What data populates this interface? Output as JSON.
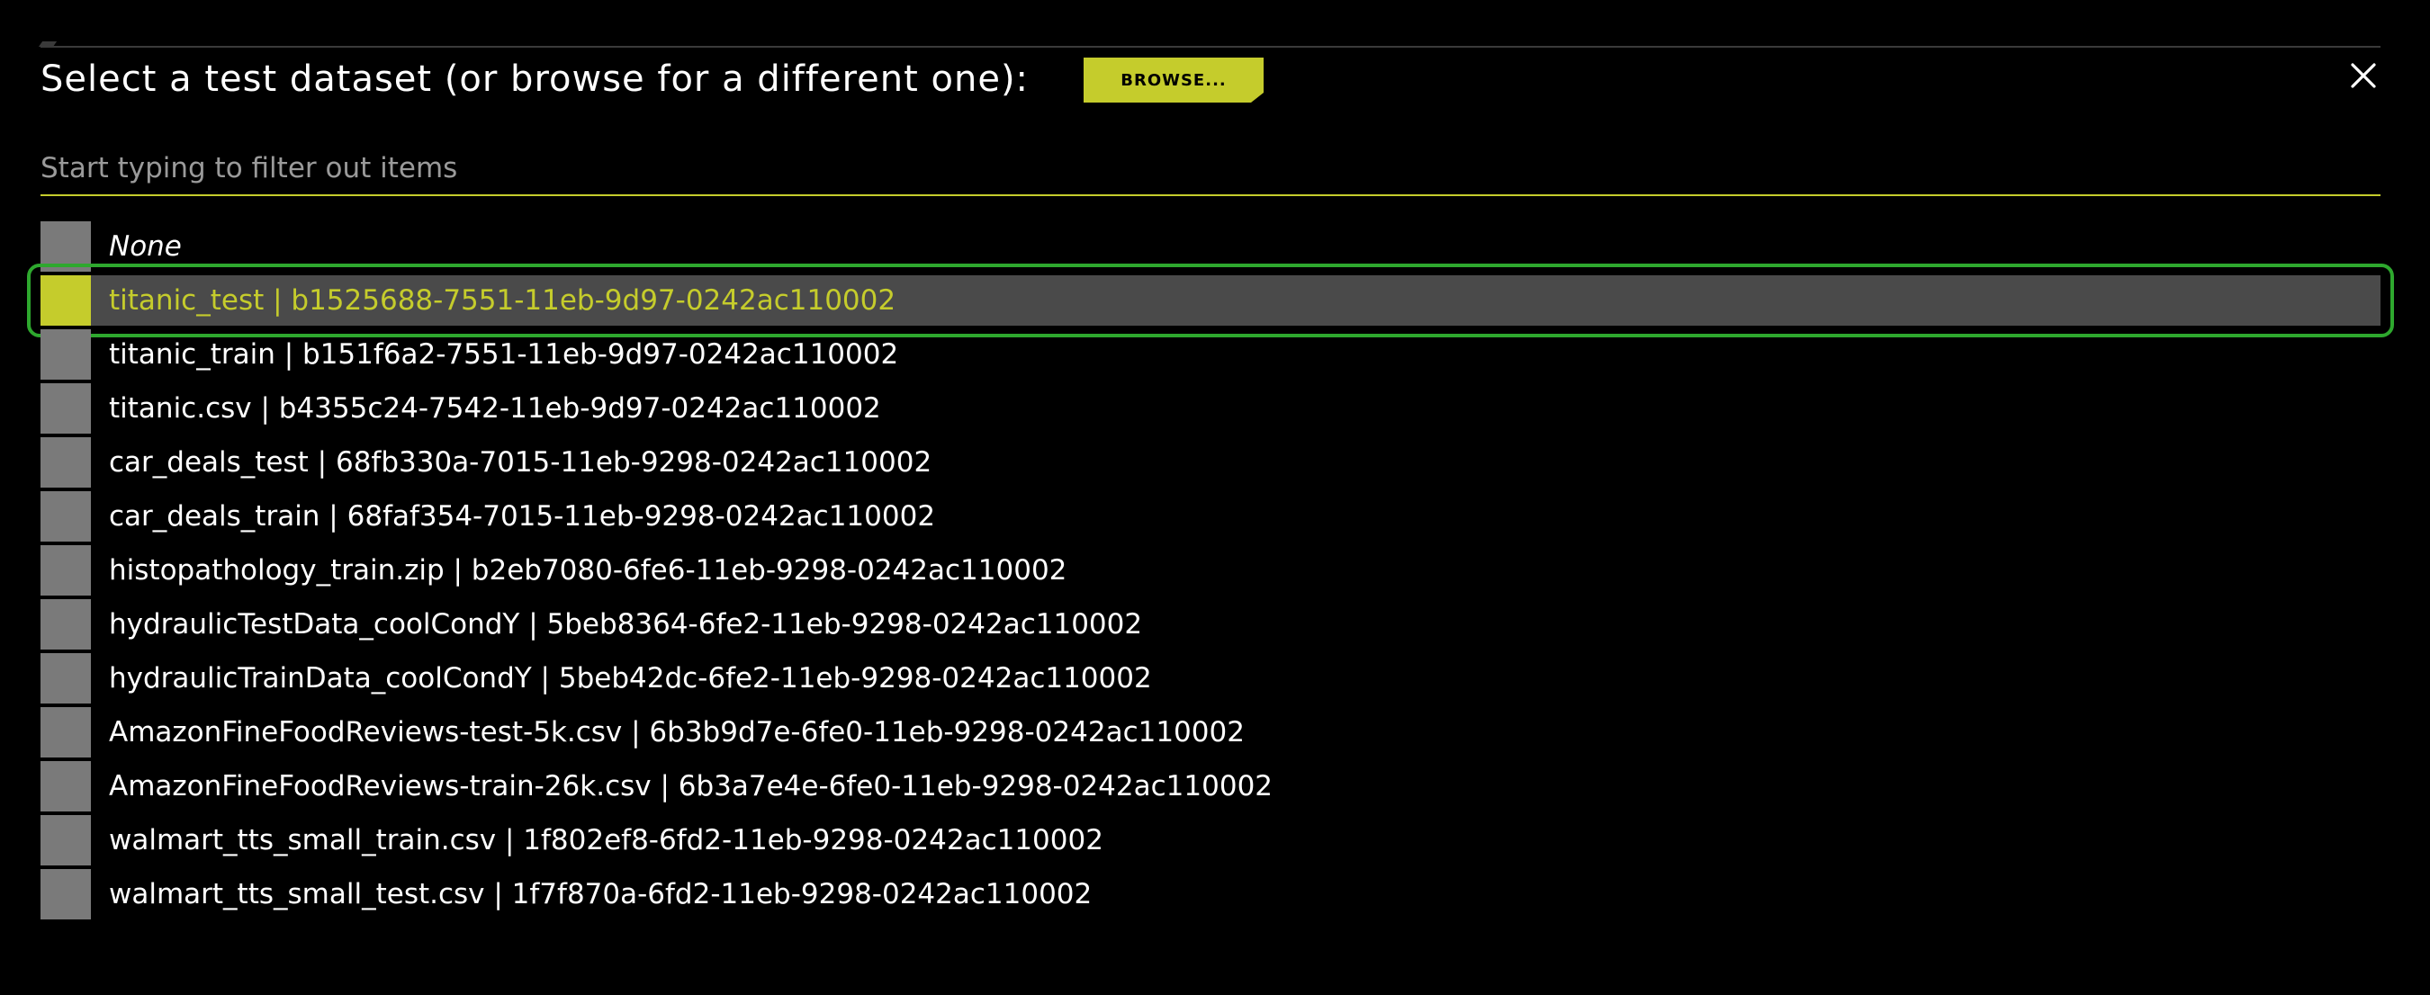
{
  "dialog": {
    "title": "Select a test dataset (or browse for a different one):",
    "browse_label": "BROWSE...",
    "close_glyph": "✕"
  },
  "filter": {
    "placeholder": "Start typing to filter out items",
    "value": ""
  },
  "items": [
    {
      "label": "None"
    },
    {
      "label": "titanic_test | b1525688-7551-11eb-9d97-0242ac110002"
    },
    {
      "label": "titanic_train | b151f6a2-7551-11eb-9d97-0242ac110002"
    },
    {
      "label": "titanic.csv | b4355c24-7542-11eb-9d97-0242ac110002"
    },
    {
      "label": "car_deals_test | 68fb330a-7015-11eb-9298-0242ac110002"
    },
    {
      "label": "car_deals_train | 68faf354-7015-11eb-9298-0242ac110002"
    },
    {
      "label": "histopathology_train.zip | b2eb7080-6fe6-11eb-9298-0242ac110002"
    },
    {
      "label": "hydraulicTestData_coolCondY | 5beb8364-6fe2-11eb-9298-0242ac110002"
    },
    {
      "label": "hydraulicTrainData_coolCondY | 5beb42dc-6fe2-11eb-9298-0242ac110002"
    },
    {
      "label": "AmazonFineFoodReviews-test-5k.csv | 6b3b9d7e-6fe0-11eb-9298-0242ac110002"
    },
    {
      "label": "AmazonFineFoodReviews-train-26k.csv | 6b3a7e4e-6fe0-11eb-9298-0242ac110002"
    },
    {
      "label": "walmart_tts_small_train.csv | 1f802ef8-6fd2-11eb-9298-0242ac110002"
    },
    {
      "label": "walmart_tts_small_test.csv | 1f7f870a-6fd2-11eb-9298-0242ac110002"
    }
  ],
  "selected_item": "titanic_test | b1525688-7551-11eb-9d97-0242ac110002",
  "colors": {
    "accent": "#c5cc2c",
    "background": "#000000",
    "selected_row": "#4a4a4a",
    "swatch": "#7a7a7a",
    "highlight_ring": "#2ea82e"
  },
  "icons": {
    "close": "close-icon"
  }
}
